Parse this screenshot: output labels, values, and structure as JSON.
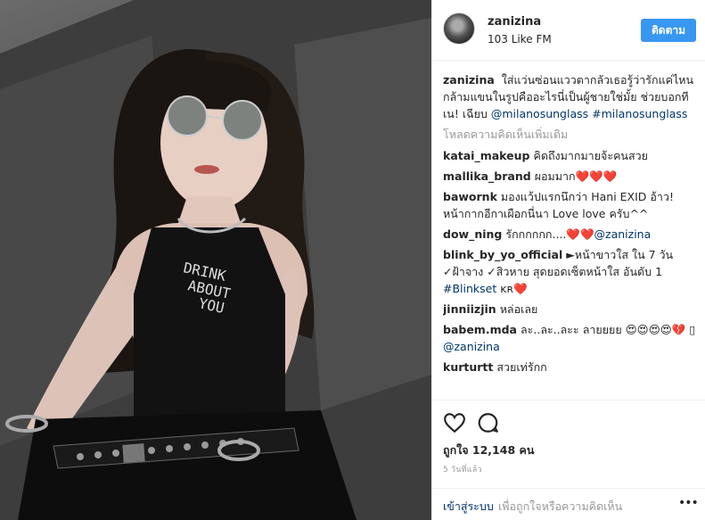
{
  "post": {
    "username": "zanizina",
    "location": "103 Like FM",
    "follow_label": "ติดตาม",
    "caption": {
      "user": "zanizina",
      "text": "ใส่แว่นซ่อนแววตากลัวเธอรู้ว่ารักแค่ไหน กล้ามแขนในรูปคืออะไรนี่เป็นผู้ชายใช่มั้ย ช่วยบอกที เน! เฉียบ",
      "mention": "@milanosunglass",
      "hashtag": "#milanosunglass"
    },
    "load_more_label": "โหลดความคิดเห็นเพิ่มเติม",
    "comments": [
      {
        "user": "katai_makeup",
        "text": "คิดถึงมากมายจ้ะคนสวย",
        "link": ""
      },
      {
        "user": "mallika_brand",
        "text": "ผอมมาก❤️❤️❤️",
        "link": ""
      },
      {
        "user": "bawornk",
        "text": "มองแว้ปแรกนึกว่า Hani EXID อ้าว! หน้ากากอีกาเผือกนี่นา Love love ครับ^^",
        "link": ""
      },
      {
        "user": "dow_ning",
        "text": "รักกกกกก....❤️❤️",
        "link": "@zanizina"
      },
      {
        "user": "blink_by_yo_official",
        "text": "►หน้าขาวใส ใน 7 วัน ✓ฝ้าจาง ✓สิวหาย สุดยอดเซ็ตหน้าใส อันดับ 1",
        "link": "#Blinkset",
        "suffix": "ᴋʀ❤️"
      },
      {
        "user": "jinniizjin",
        "text": "หล่อเลย",
        "link": ""
      },
      {
        "user": "babem.mda",
        "text": "ละ..ละ..ละะ ลายยยย 😍😍😍😍💔 ▯",
        "link": "@zanizina"
      },
      {
        "user": "kurturtt",
        "text": "สวยเท่รักก",
        "link": ""
      }
    ],
    "likes": "ถูกใจ 12,148 คน",
    "time": "5 วันที่แล้ว",
    "login_link": "เข้าสู่ระบบ",
    "login_text": "เพื่อถูกใจหรือความคิดเห็น",
    "icons": {
      "like": "heart-icon",
      "comment": "comment-bubble-icon",
      "more": "more-options-icon"
    },
    "colors": {
      "follow": "#3897f0",
      "link": "#003569",
      "muted": "#999999"
    }
  }
}
